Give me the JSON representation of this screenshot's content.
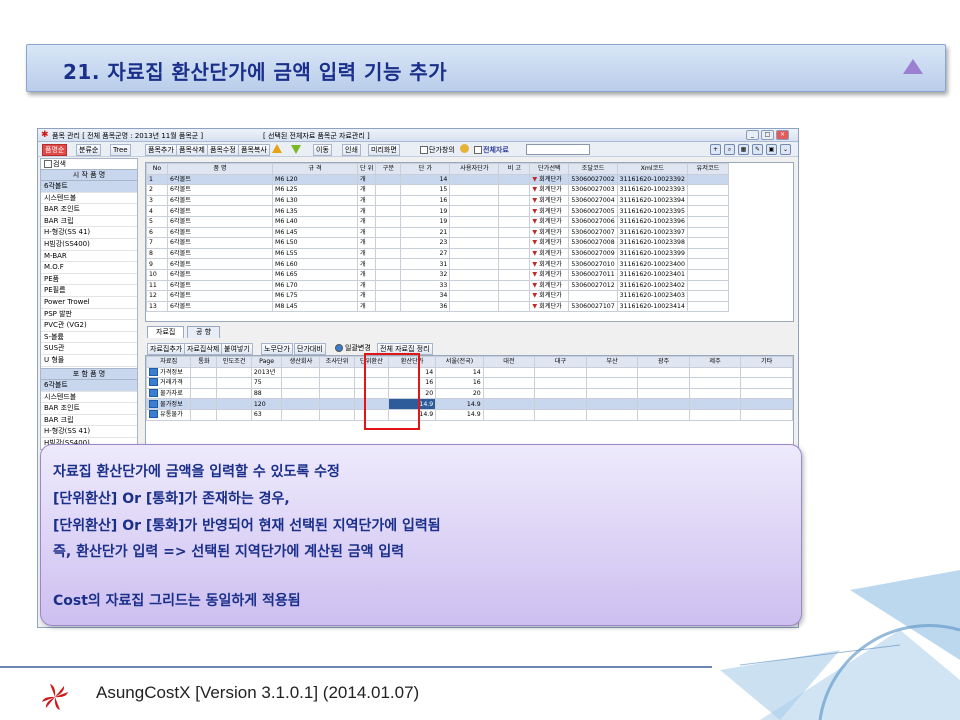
{
  "slide": {
    "title": "21. 자료집 환산단가에 금액 입력 기능 추가",
    "footer_text": "AsungCostX    [Version 3.1.0.1]    (2014.01.07)",
    "callout_lines": [
      "자료집 환산단가에 금액을 입력할 수 있도록 수정",
      "[단위환산] Or [통화]가 존재하는 경우,",
      "[단위환산] Or [통화]가 반영되어 현재 선택된 지역단가에 입력됨",
      "즉, 환산단가 입력 => 선택된 지역단가에 계산된 금액 입력",
      "",
      "Cost의 자료집 그리드는 동일하게 적용됨"
    ],
    "colors": {
      "title": "#1a2f8a",
      "callout_bg": "#d9cff5",
      "highlight": "#e01515"
    }
  },
  "app": {
    "title": "품목 관리 [ 전체 품목군명 : 2013년 11월 품목군 ]",
    "title_selection": "[ 선택된 전체자료 품목군 자료관리 ]",
    "toolbar": {
      "left_tabs": [
        "품명순",
        "분류순",
        "Tree"
      ],
      "buttons": [
        "품목추가",
        "품목삭제",
        "품목수정",
        "품목복사",
        "이동",
        "인쇄",
        "미리화면"
      ],
      "check_label": "단가창의",
      "check_label2": "전체자료"
    },
    "left_panel": {
      "search_label": "검색",
      "head1": "시 작 품 명",
      "items1": [
        "6각볼트",
        "시스텐드볼",
        "BAR 조인트",
        "BAR 크립",
        "H-형강(SS 41)",
        "H빔강(SS400)",
        "M-BAR",
        "M.O.F",
        "PE품",
        "PE필름",
        "Power Trowel",
        "PSP 발판",
        "PVC관 (VG2)",
        "S-볼륨",
        "SUS관",
        "U 형몰"
      ],
      "head2": "포 함 품 명",
      "items2": [
        "6각볼트",
        "시스텐드볼",
        "BAR 조인트",
        "BAR 크립",
        "H-형강(SS 41)",
        "H빔강(SS400)"
      ]
    },
    "grid": {
      "headers": [
        "No",
        "품 명",
        "규 격",
        "단 위",
        "구분",
        "단 가",
        "사용자단가",
        "비 고",
        "단가선택",
        "조달코드",
        "Xml코드",
        "유저코드"
      ],
      "rows": [
        [
          "1",
          "6각볼트",
          "M6",
          "L20",
          "개",
          "14",
          "",
          "회계단가",
          "53060027002",
          "31161620-10023392"
        ],
        [
          "2",
          "6각볼트",
          "M6",
          "L25",
          "개",
          "15",
          "",
          "회계단가",
          "53060027003",
          "31161620-10023393"
        ],
        [
          "3",
          "6각볼트",
          "M6",
          "L30",
          "개",
          "16",
          "",
          "회계단가",
          "53060027004",
          "31161620-10023394"
        ],
        [
          "4",
          "6각볼트",
          "M6",
          "L35",
          "개",
          "19",
          "",
          "회계단가",
          "53060027005",
          "31161620-10023395"
        ],
        [
          "5",
          "6각볼트",
          "M6",
          "L40",
          "개",
          "19",
          "",
          "회계단가",
          "53060027006",
          "31161620-10023396"
        ],
        [
          "6",
          "6각볼트",
          "M6",
          "L45",
          "개",
          "21",
          "",
          "회계단가",
          "53060027007",
          "31161620-10023397"
        ],
        [
          "7",
          "6각볼트",
          "M6",
          "L50",
          "개",
          "23",
          "",
          "회계단가",
          "53060027008",
          "31161620-10023398"
        ],
        [
          "8",
          "6각볼트",
          "M6",
          "L55",
          "개",
          "27",
          "",
          "회계단가",
          "53060027009",
          "31161620-10023399"
        ],
        [
          "9",
          "6각볼트",
          "M6",
          "L60",
          "개",
          "31",
          "",
          "회계단가",
          "53060027010",
          "31161620-10023400"
        ],
        [
          "10",
          "6각볼트",
          "M6",
          "L65",
          "개",
          "32",
          "",
          "회계단가",
          "53060027011",
          "31161620-10023401"
        ],
        [
          "11",
          "6각볼트",
          "M6",
          "L70",
          "개",
          "33",
          "",
          "회계단가",
          "53060027012",
          "31161620-10023402"
        ],
        [
          "12",
          "6각볼트",
          "M6",
          "L75",
          "개",
          "34",
          "",
          "회계단가",
          "",
          "31161620-10023403"
        ],
        [
          "13",
          "6각볼트",
          "M8",
          "L45",
          "개",
          "36",
          "",
          "회계단가",
          "53060027107",
          "31161620-10023414"
        ]
      ]
    },
    "tabs": [
      "자료집",
      "공 향"
    ],
    "lower_buttons": [
      "자료집추가",
      "자료집삭제",
      "붙여넣기",
      "노무단가",
      "단가대비",
      "일괄변경",
      "전체 자료집 정리"
    ],
    "lower_grid": {
      "headers": [
        "자료집",
        "통화",
        "인도조건",
        "Page",
        "생산회사",
        "조사단위",
        "단위환산",
        "환산단가",
        "서울(전국)",
        "대전",
        "대구",
        "부산",
        "광주",
        "제주",
        "기타"
      ],
      "rows": [
        [
          "가격정보",
          "",
          "",
          "2013년",
          "",
          "",
          "",
          "14",
          "14"
        ],
        [
          "거래가격",
          "",
          "",
          "75",
          "",
          "",
          "",
          "16",
          "16"
        ],
        [
          "물가자료",
          "",
          "",
          "88",
          "",
          "",
          "",
          "20",
          "20"
        ],
        [
          "물가정보",
          "",
          "",
          "120",
          "",
          "",
          "",
          "14.9",
          "14.9"
        ],
        [
          "유통물가",
          "",
          "",
          "63",
          "",
          "",
          "",
          "14.9",
          "14.9"
        ]
      ]
    }
  }
}
